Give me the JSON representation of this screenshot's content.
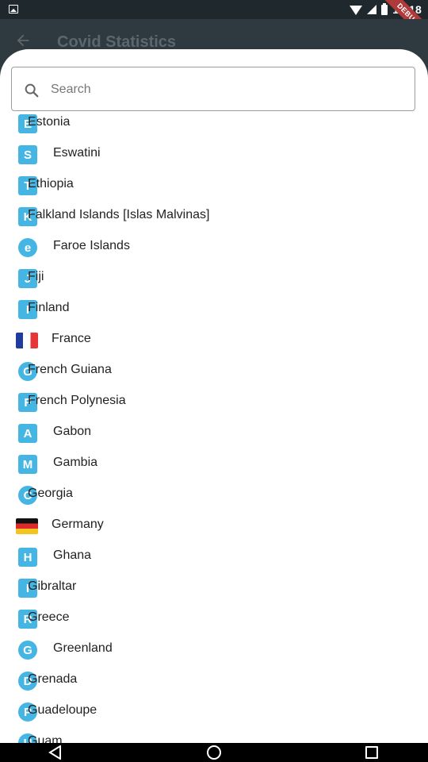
{
  "status": {
    "time": "10:18",
    "debug_label": "DEBUG",
    "icons": [
      "image-notification-icon",
      "wifi-icon",
      "signal-icon",
      "battery-icon"
    ]
  },
  "appbar": {
    "title": "Covid Statistics",
    "back_icon": "arrow-left-icon"
  },
  "search": {
    "placeholder": "Search",
    "value": ""
  },
  "countries": [
    {
      "name": "Estonia",
      "flag": "E"
    },
    {
      "name": "Eswatini",
      "flag": "S"
    },
    {
      "name": "Ethiopia",
      "flag": "T"
    },
    {
      "name": "Falkland Islands [Islas Malvinas]",
      "flag": "K"
    },
    {
      "name": "Faroe Islands",
      "flag": "e"
    },
    {
      "name": "Fiji",
      "flag": "J"
    },
    {
      "name": "Finland",
      "flag": "I"
    },
    {
      "name": "France",
      "flag": "fr"
    },
    {
      "name": "French Guiana",
      "flag": "G"
    },
    {
      "name": "French Polynesia",
      "flag": "F"
    },
    {
      "name": "Gabon",
      "flag": "A"
    },
    {
      "name": "Gambia",
      "flag": "M"
    },
    {
      "name": "Georgia",
      "flag": "C"
    },
    {
      "name": "Germany",
      "flag": "de"
    },
    {
      "name": "Ghana",
      "flag": "H"
    },
    {
      "name": "Gibraltar",
      "flag": "I"
    },
    {
      "name": "Greece",
      "flag": "R"
    },
    {
      "name": "Greenland",
      "flag": "G"
    },
    {
      "name": "Grenada",
      "flag": "D"
    },
    {
      "name": "Guadeloupe",
      "flag": "P"
    },
    {
      "name": "Guam",
      "flag": "U"
    }
  ],
  "colors": {
    "flag_placeholder": "#45b6e4",
    "sheet": "#ffffff",
    "appbar": "#2f3a40"
  }
}
